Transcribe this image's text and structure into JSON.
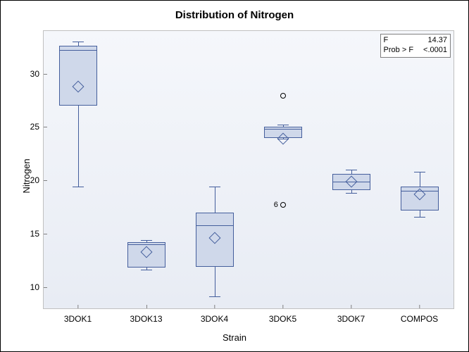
{
  "chart_data": {
    "type": "box",
    "title": "Distribution of Nitrogen",
    "xlabel": "Strain",
    "ylabel": "Nitrogen",
    "ylim": [
      8,
      34
    ],
    "yticks": [
      10,
      15,
      20,
      25,
      30
    ],
    "categories": [
      "3DOK1",
      "3DOK13",
      "3DOK4",
      "3DOK5",
      "3DOK7",
      "COMPOS"
    ],
    "series": [
      {
        "name": "3DOK1",
        "min": 19.4,
        "q1": 27.0,
        "median": 32.2,
        "q3": 32.6,
        "max": 33.0,
        "mean": 28.8,
        "outliers": []
      },
      {
        "name": "3DOK13",
        "min": 11.6,
        "q1": 11.8,
        "median": 14.0,
        "q3": 14.2,
        "max": 14.4,
        "mean": 13.3,
        "outliers": []
      },
      {
        "name": "3DOK4",
        "min": 9.1,
        "q1": 11.9,
        "median": 15.8,
        "q3": 17.0,
        "max": 19.4,
        "mean": 14.6,
        "outliers": []
      },
      {
        "name": "3DOK5",
        "min": 23.9,
        "q1": 24.0,
        "median": 24.8,
        "q3": 25.0,
        "max": 25.2,
        "mean": 23.9,
        "outliers": [
          {
            "value": 27.9,
            "label": ""
          },
          {
            "value": 17.7,
            "label": "6"
          }
        ]
      },
      {
        "name": "3DOK7",
        "min": 18.8,
        "q1": 19.1,
        "median": 19.9,
        "q3": 20.6,
        "max": 21.0,
        "mean": 19.9,
        "outliers": []
      },
      {
        "name": "COMPOS",
        "min": 16.6,
        "q1": 17.2,
        "median": 19.0,
        "q3": 19.4,
        "max": 20.8,
        "mean": 18.7,
        "outliers": []
      }
    ],
    "stats": {
      "f_label": "F",
      "f_value": "14.37",
      "p_label": "Prob > F",
      "p_value": "<.0001"
    }
  }
}
